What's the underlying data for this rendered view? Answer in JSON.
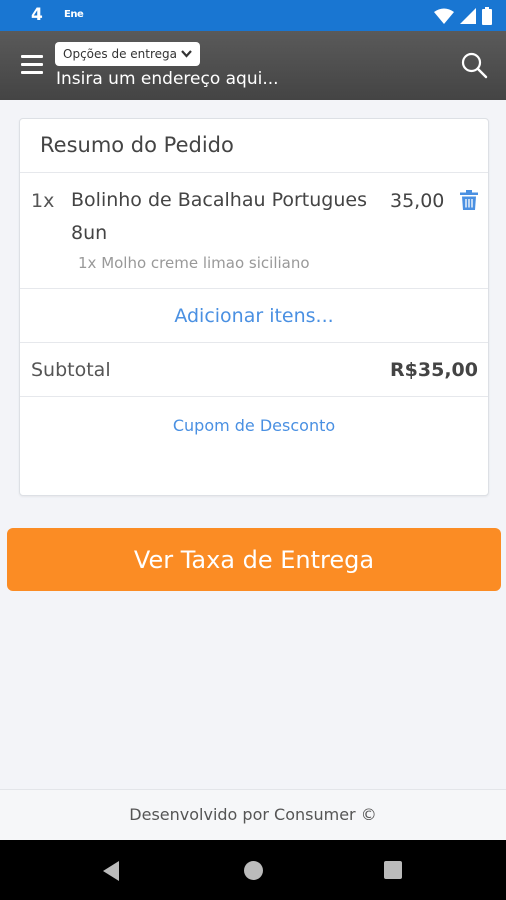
{
  "status_bar": {
    "time": "4",
    "app_indicator": "Ene"
  },
  "header": {
    "delivery_options_label": "Opções de entrega",
    "address_placeholder": "Insira um endereço aqui..."
  },
  "order_summary": {
    "title": "Resumo do Pedido",
    "items": [
      {
        "quantity": "1x",
        "name": "Bolinho de Bacalhau Portugues 8un",
        "price": "35,00",
        "option": "1x Molho creme limao siciliano"
      }
    ],
    "add_items_label": "Adicionar itens...",
    "subtotal_label": "Subtotal",
    "subtotal_value": "R$35,00",
    "coupon_label": "Cupom de Desconto"
  },
  "cta": {
    "label": "Ver Taxa de Entrega"
  },
  "footer": {
    "text": "Desenvolvido por Consumer ©"
  },
  "colors": {
    "status_bar": "#1976d2",
    "accent_orange": "#fb8c24",
    "link_blue": "#4a90e2"
  },
  "icons": [
    "wifi-icon",
    "signal-icon",
    "battery-icon",
    "menu-icon",
    "chevron-down-icon",
    "search-icon",
    "trash-icon",
    "back-icon",
    "home-icon",
    "recents-icon"
  ]
}
